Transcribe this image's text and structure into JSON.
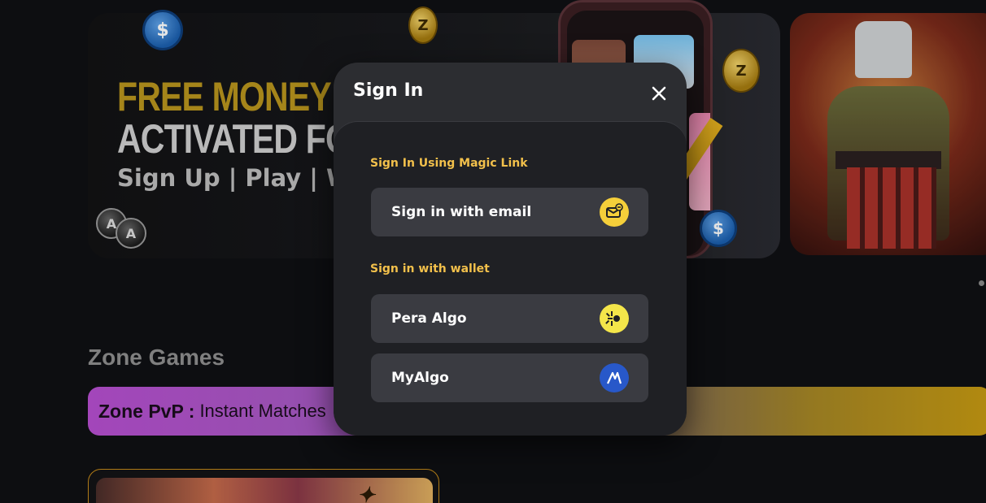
{
  "hero": {
    "title_line_1": "FREE MONEY GAM",
    "title_line_2": "ACTIVATED FOR N",
    "subtitle": "Sign Up | Play | W"
  },
  "games_section": {
    "title": "Zone Games",
    "pvp_banner": {
      "title": "Zone PvP :",
      "description": "Instant Matches"
    }
  },
  "modal": {
    "title": "Sign In",
    "close_icon": "close-icon",
    "magic_link": {
      "heading": "Sign In Using Magic Link",
      "options": [
        {
          "label": "Sign in with email",
          "icon": "email-link-icon",
          "icon_color": "#f5cf3a"
        }
      ]
    },
    "wallet": {
      "heading": "Sign in with wallet",
      "options": [
        {
          "label": "Pera Algo",
          "icon": "pera-wallet-icon",
          "icon_color": "#f4e64a"
        },
        {
          "label": "MyAlgo",
          "icon": "myalgo-icon",
          "icon_color": "#2858c9"
        }
      ]
    }
  },
  "colors": {
    "accent_yellow": "#f2c04b",
    "modal_bg": "#2c2d31",
    "option_bg": "#3a3b41"
  }
}
